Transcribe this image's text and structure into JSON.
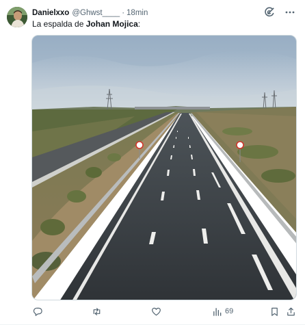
{
  "post": {
    "display_name": "Danielxxo",
    "handle": "@Ghwst____",
    "separator": "·",
    "timestamp": "18min",
    "text_prefix": "La espalda de ",
    "text_bold": "Johan Mojica",
    "text_suffix": ":",
    "views_count": "69"
  },
  "icons": {
    "avatar": "avatar-photo",
    "grok": "grok-icon",
    "more": "more-icon",
    "reply": "reply-icon",
    "repost": "repost-icon",
    "like": "heart-icon",
    "views": "views-icon",
    "bookmark": "bookmark-icon",
    "share": "share-icon"
  },
  "colors": {
    "text": "#0f1419",
    "muted": "#536471",
    "border": "#cfd9de"
  }
}
